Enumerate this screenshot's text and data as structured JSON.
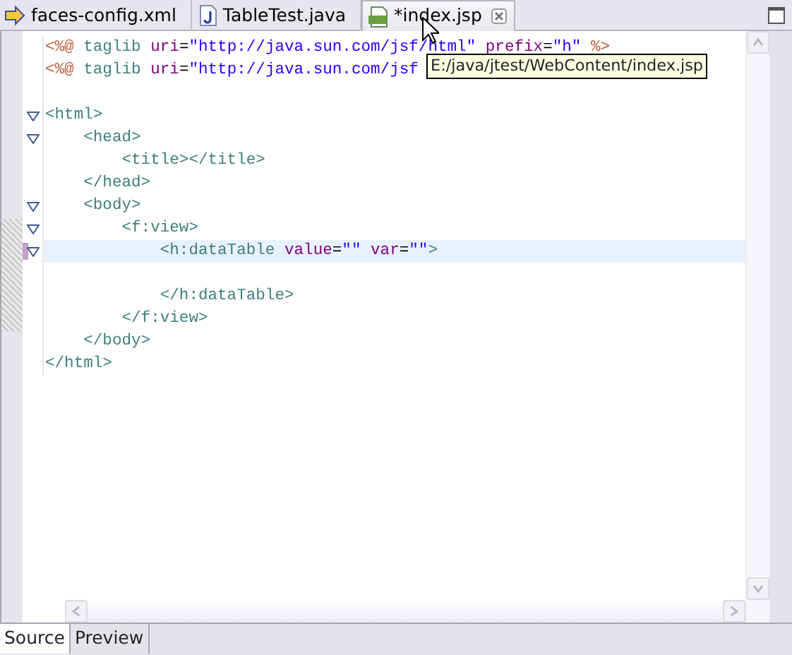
{
  "editor_tabs": [
    {
      "label": "faces-config.xml",
      "kind": "xml",
      "selected": false
    },
    {
      "label": "TableTest.java",
      "kind": "java",
      "selected": false
    },
    {
      "label": "*index.jsp",
      "kind": "jsp",
      "selected": true
    }
  ],
  "code_lines": [
    {
      "kind": "code",
      "foldable": false,
      "selected": false,
      "tokens": [
        {
          "kind": "directive",
          "text": "<%@"
        },
        {
          "kind": "tag",
          "text": " taglib"
        },
        {
          "kind": "attr",
          "text": " uri"
        },
        {
          "kind": "plain",
          "text": "="
        },
        {
          "kind": "value",
          "text": "\"http://java.sun.com/jsf/html\""
        },
        {
          "kind": "attr",
          "text": " prefix"
        },
        {
          "kind": "plain",
          "text": "="
        },
        {
          "kind": "value",
          "text": "\"h\""
        },
        {
          "kind": "directive",
          "text": " %>"
        }
      ]
    },
    {
      "kind": "code",
      "foldable": false,
      "selected": false,
      "tokens": [
        {
          "kind": "directive",
          "text": "<%@"
        },
        {
          "kind": "tag",
          "text": " taglib"
        },
        {
          "kind": "attr",
          "text": " uri"
        },
        {
          "kind": "plain",
          "text": "="
        },
        {
          "kind": "value",
          "text": "\"http://java.sun.com/jsf"
        }
      ]
    },
    {
      "kind": "blank"
    },
    {
      "kind": "code",
      "foldable": true,
      "selected": false,
      "tokens": [
        {
          "kind": "tag",
          "text": "<html>"
        }
      ]
    },
    {
      "kind": "code",
      "foldable": true,
      "selected": false,
      "tokens": [
        {
          "kind": "tag",
          "text": "    <head>"
        }
      ]
    },
    {
      "kind": "code",
      "foldable": false,
      "selected": false,
      "tokens": [
        {
          "kind": "tag",
          "text": "        <title></title>"
        }
      ]
    },
    {
      "kind": "code",
      "foldable": false,
      "selected": false,
      "tokens": [
        {
          "kind": "tag",
          "text": "    </head>"
        }
      ]
    },
    {
      "kind": "code",
      "foldable": true,
      "selected": false,
      "tokens": [
        {
          "kind": "tag",
          "text": "    <body>"
        }
      ]
    },
    {
      "kind": "code",
      "foldable": true,
      "selected": false,
      "tokens": [
        {
          "kind": "tag",
          "text": "        <f:view>"
        }
      ]
    },
    {
      "kind": "code",
      "foldable": true,
      "selected": true,
      "tokens": [
        {
          "kind": "tag",
          "text": "            <h:dataTable"
        },
        {
          "kind": "attr",
          "text": " value"
        },
        {
          "kind": "plain",
          "text": "="
        },
        {
          "kind": "value",
          "text": "\"\""
        },
        {
          "kind": "attr",
          "text": " var"
        },
        {
          "kind": "plain",
          "text": "="
        },
        {
          "kind": "value",
          "text": "\"\""
        },
        {
          "kind": "tag",
          "text": ">"
        }
      ]
    },
    {
      "kind": "blank"
    },
    {
      "kind": "code",
      "foldable": false,
      "selected": false,
      "tokens": [
        {
          "kind": "tag",
          "text": "            </h:dataTable>"
        }
      ]
    },
    {
      "kind": "code",
      "foldable": false,
      "selected": false,
      "tokens": [
        {
          "kind": "tag",
          "text": "        </f:view>"
        }
      ]
    },
    {
      "kind": "code",
      "foldable": false,
      "selected": false,
      "tokens": [
        {
          "kind": "tag",
          "text": "    </body>"
        }
      ]
    },
    {
      "kind": "code",
      "foldable": false,
      "selected": false,
      "tokens": [
        {
          "kind": "tag",
          "text": "</html>"
        }
      ]
    }
  ],
  "tooltip": "E:/java/jtest/WebContent/index.jsp",
  "bottom_tabs": [
    {
      "label": "Source",
      "selected": true
    },
    {
      "label": "Preview",
      "selected": false
    }
  ]
}
